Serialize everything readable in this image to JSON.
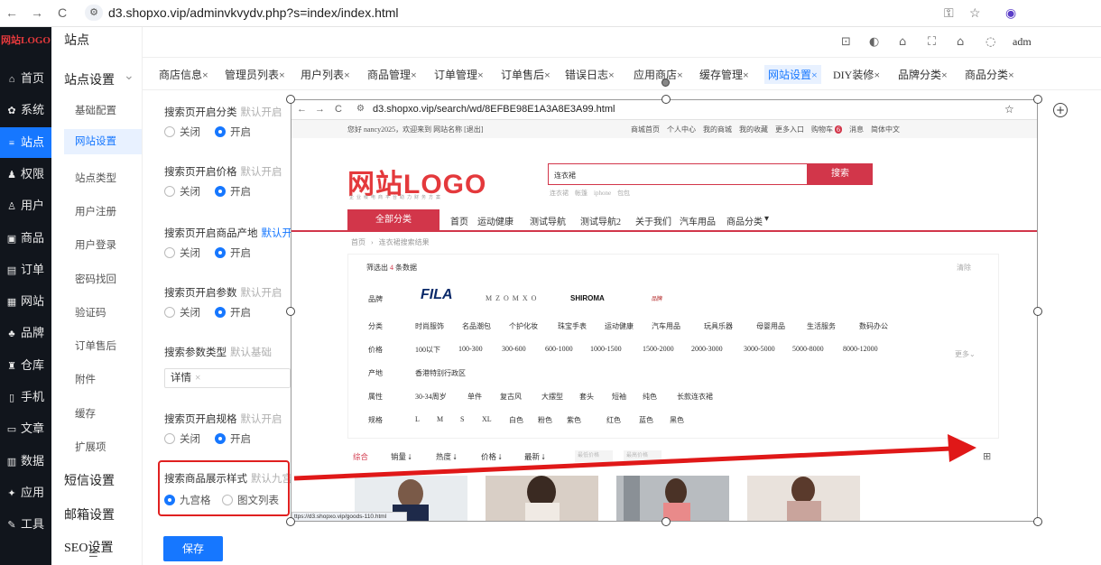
{
  "browser": {
    "back": "←",
    "forward": "→",
    "reload": "C",
    "chip": "⚙",
    "url": "d3.shopxo.vip/adminvkvydv.php?s=index/index.html",
    "icons": [
      "key-icon",
      "star-icon",
      "profile-icon"
    ]
  },
  "sidebar": {
    "logo": "网站LOGO",
    "items": [
      {
        "icon": "⌂",
        "label": "首页"
      },
      {
        "icon": "✿",
        "label": "系统"
      },
      {
        "icon": "≡",
        "label": "站点"
      },
      {
        "icon": "♟",
        "label": "权限"
      },
      {
        "icon": "♙",
        "label": "用户"
      },
      {
        "icon": "▣",
        "label": "商品"
      },
      {
        "icon": "▤",
        "label": "订单"
      },
      {
        "icon": "▦",
        "label": "网站"
      },
      {
        "icon": "♣",
        "label": "品牌"
      },
      {
        "icon": "♜",
        "label": "仓库"
      },
      {
        "icon": "▯",
        "label": "手机"
      },
      {
        "icon": "▭",
        "label": "文章"
      },
      {
        "icon": "▥",
        "label": "数据"
      },
      {
        "icon": "✦",
        "label": "应用"
      },
      {
        "icon": "✎",
        "label": "工具"
      }
    ],
    "active_index": 2
  },
  "submenu": {
    "head": "站点",
    "group": "站点设置",
    "group_chevron": "⌄",
    "items": [
      "基础配置",
      "网站设置",
      "站点类型",
      "用户注册",
      "用户登录",
      "密码找回",
      "验证码",
      "订单售后",
      "附件",
      "缓存",
      "扩展项"
    ],
    "active_index": 1,
    "groups_after": [
      "短信设置",
      "邮箱设置",
      "SEO设置"
    ]
  },
  "toolbar": {
    "icons": [
      "⊡",
      "◐",
      "⌂",
      "⛶",
      "⌂",
      "◌"
    ],
    "user": "adm"
  },
  "tabs": [
    "商店信息",
    "管理员列表",
    "用户列表",
    "商品管理",
    "订单管理",
    "订单售后",
    "错误日志",
    "应用商店",
    "缓存管理",
    "网站设置",
    "DIY装修",
    "品牌分类",
    "商品分类"
  ],
  "tabs_close": "×",
  "active_tab": 9,
  "form": {
    "sections": [
      {
        "label": "搜索页开启分类",
        "hint": "默认开启",
        "off": "关闭",
        "on": "开启",
        "selected": "on"
      },
      {
        "label": "搜索页开启价格",
        "hint": "默认开启",
        "off": "关闭",
        "on": "开启",
        "selected": "on"
      },
      {
        "label": "搜索页开启商品产地",
        "hint": "默认开启",
        "off": "关闭",
        "on": "开启",
        "selected": "on"
      },
      {
        "label": "搜索页开启参数",
        "hint": "默认开启",
        "off": "关闭",
        "on": "开启",
        "selected": "on"
      },
      {
        "label": "搜索参数类型",
        "hint": "默认基础"
      },
      {
        "label": "搜索页开启规格",
        "hint": "默认开启",
        "off": "关闭",
        "on": "开启",
        "selected": "on"
      },
      {
        "label": "搜索商品展示样式",
        "hint": "默认九宫格",
        "opt1": "九宫格",
        "opt2": "图文列表",
        "selected": "opt1"
      }
    ],
    "tag": "详情",
    "tag_close": "×",
    "save": "保存"
  },
  "preview": {
    "url": "d3.shopxo.vip/search/wd/8EFBE98E1A3A8E3A99.html",
    "topbar_left": "您好 nancy2025，欢迎来到 网站名称 [退出]",
    "topbar_right": [
      "商城首页",
      "个人中心",
      "我的商城",
      "我的收藏",
      "更多入口",
      "购物车",
      "消息",
      "简体中文"
    ],
    "cart_count": "6",
    "logo": "网站LOGO",
    "slogan": "企业级电商平台助力财务方案",
    "search_value": "连衣裙",
    "search_btn": "搜索",
    "hot": [
      "连衣裙",
      "帐篷",
      "iphone",
      "包包"
    ],
    "all_category": "全部分类",
    "nav": [
      "首页",
      "运动健康",
      "测试导航",
      "测试导航2",
      "关于我们",
      "汽车用品",
      "商品分类"
    ],
    "nav_more": "▾",
    "crumb": [
      "首页",
      "连衣裙搜索结果"
    ],
    "count_prefix": "筛选出",
    "count": "4",
    "count_suffix": "条数据",
    "clear": "清除",
    "rows": [
      {
        "label": "品牌",
        "opts": [
          "FILA",
          "M Z O M X O",
          "SHIROMA",
          "品牌"
        ]
      },
      {
        "label": "分类",
        "opts": [
          "时尚服饰",
          "名品潮包",
          "个护化妆",
          "珠宝手表",
          "运动健康",
          "汽车用品",
          "玩具乐器",
          "母婴用品",
          "生活服务",
          "数码办公"
        ]
      },
      {
        "label": "价格",
        "opts": [
          "100以下",
          "100-300",
          "300-600",
          "600-1000",
          "1000-1500",
          "1500-2000",
          "2000-3000",
          "3000-5000",
          "5000-8000",
          "8000-12000"
        ]
      },
      {
        "label": "产地",
        "opts": [
          "香港特别行政区"
        ]
      },
      {
        "label": "属性",
        "opts": [
          "30-34周岁",
          "单件",
          "复古风",
          "大摆型",
          "套头",
          "短袖",
          "纯色",
          "长款连衣裙"
        ]
      },
      {
        "label": "规格",
        "opts": [
          "L",
          "M",
          "S",
          "XL",
          "白色",
          "粉色",
          "紫色",
          "红色",
          "蓝色",
          "黑色"
        ]
      }
    ],
    "more": "更多⌄",
    "sorts": [
      "综合",
      "销量 ⭣",
      "热度 ⭣",
      "价格 ⭣",
      "最新 ⭣"
    ],
    "price_min": "最低价格",
    "price_max": "最高价格",
    "grid_icon": "⊞",
    "status_url": "ttps://d3.shopxo.vip/goods-110.html"
  }
}
